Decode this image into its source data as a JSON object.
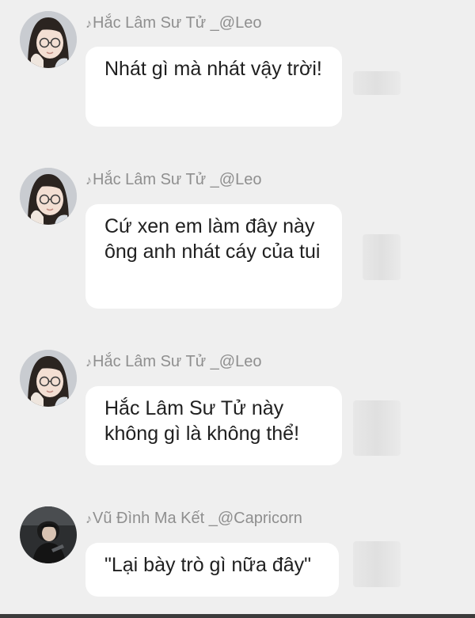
{
  "messages": [
    {
      "sender": "Hắc Lâm Sư Tử _@Leo",
      "text": "Nhát gì mà nhát vậy trời!",
      "avatar": "girl-avatar-icon"
    },
    {
      "sender": "Hắc Lâm Sư Tử _@Leo",
      "text": "Cứ xen em làm đây này ông anh nhát cáy của tui",
      "avatar": "girl-avatar-icon"
    },
    {
      "sender": "Hắc Lâm Sư Tử _@Leo",
      "text": "Hắc Lâm Sư Tử này không gì là không thể!",
      "avatar": "girl-avatar-icon"
    },
    {
      "sender": "Vũ Đình Ma Kết _@Capricorn",
      "text": "\"Lại bày trò gì nữa đây\"",
      "avatar": "boy-avatar-icon"
    }
  ],
  "music_note": "♪",
  "colors": {
    "background": "#efefef",
    "bubble": "#ffffff",
    "sender_text": "#8f8f8f",
    "message_text": "#202020"
  }
}
